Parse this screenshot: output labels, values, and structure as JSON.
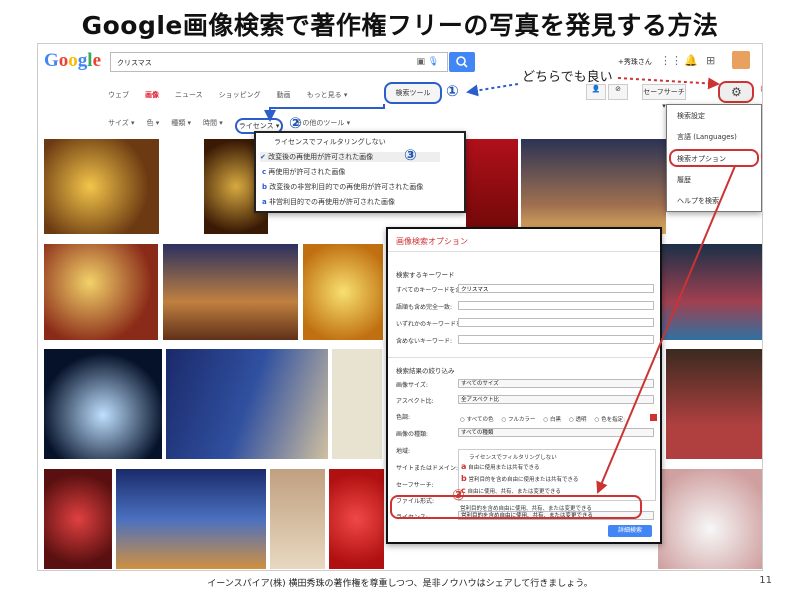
{
  "slide": {
    "title": "Google画像検索で著作権フリーの写真を発見する方法",
    "footer": "イーンスパイア(株) 横田秀珠の著作権を尊重しつつ、是非ノウハウはシェアして行きましょう。",
    "page_number": "11"
  },
  "topbar": {
    "logo": "Google",
    "query": "クリスマス",
    "user": "+秀珠さん"
  },
  "tabs": [
    "ウェブ",
    "画像",
    "ニュース",
    "ショッピング",
    "動画",
    "もっと見る ▾"
  ],
  "tools": {
    "search_tools": "検索ツール",
    "safesearch": "セーフサーチ ▾"
  },
  "filters": [
    "サイズ ▾",
    "色 ▾",
    "種類 ▾",
    "時間 ▾",
    "ライセンス ▾",
    "その他のツール ▾"
  ],
  "license_menu": [
    {
      "mark": "",
      "label": "ライセンスでフィルタリングしない"
    },
    {
      "mark": "✔",
      "label": "改変後の再使用が許可された画像"
    },
    {
      "mark": "c",
      "label": "再使用が許可された画像"
    },
    {
      "mark": "b",
      "label": "改変後の非営利目的での再使用が許可された画像"
    },
    {
      "mark": "a",
      "label": "非営利目的での再使用が許可された画像"
    }
  ],
  "settings_menu": [
    "検索設定",
    "言語 (Languages)",
    "検索オプション",
    "履歴",
    "ヘルプを検索"
  ],
  "dialog": {
    "title": "画像検索オプション",
    "keywords_heading": "検索するキーワード",
    "keyword_rows": [
      {
        "label": "すべてのキーワードを含む:",
        "value": "クリスマス"
      },
      {
        "label": "語順も含め完全一致:",
        "value": ""
      },
      {
        "label": "いずれかのキーワードを含む:",
        "value": ""
      },
      {
        "label": "含めないキーワード:",
        "value": ""
      }
    ],
    "filter_heading": "検索結果の絞り込み",
    "filter_rows": [
      {
        "label": "画像サイズ:",
        "value": "すべてのサイズ"
      },
      {
        "label": "アスペクト比:",
        "value": "全アスペクト比"
      },
      {
        "label": "色調:",
        "value": ""
      },
      {
        "label": "画像の種類:",
        "value": "すべての種類"
      },
      {
        "label": "地域:",
        "value": ""
      },
      {
        "label": "サイトまたはドメイン:",
        "value": ""
      },
      {
        "label": "セーフサーチ:",
        "value": ""
      },
      {
        "label": "ファイル形式:",
        "value": ""
      },
      {
        "label": "ライセンス:",
        "value": "営利目的を含め自由に使用、共有、または変更できる"
      }
    ],
    "color_options": [
      "すべての色",
      "フルカラー",
      "白黒",
      "透明",
      "色を指定:"
    ],
    "license_options": [
      {
        "mark": "",
        "label": "ライセンスでフィルタリングしない"
      },
      {
        "mark": "a",
        "label": "自由に使用または共有できる"
      },
      {
        "mark": "b",
        "label": "営利目的を含め自由に使用または共有できる"
      },
      {
        "mark": "c",
        "label": "自由に使用、共有、または変更できる"
      },
      {
        "mark": "",
        "label": "営利目的を含め自由に使用、共有、または変更できる"
      }
    ],
    "submit": "詳細検索"
  },
  "annotations": {
    "either_ok": "どちらでも良い",
    "n1": "①",
    "n2": "②",
    "n3": "③"
  },
  "colors": {
    "accent": "#4285f4",
    "annotation_red": "#cc3333",
    "annotation_blue": "#2b5dcb"
  }
}
